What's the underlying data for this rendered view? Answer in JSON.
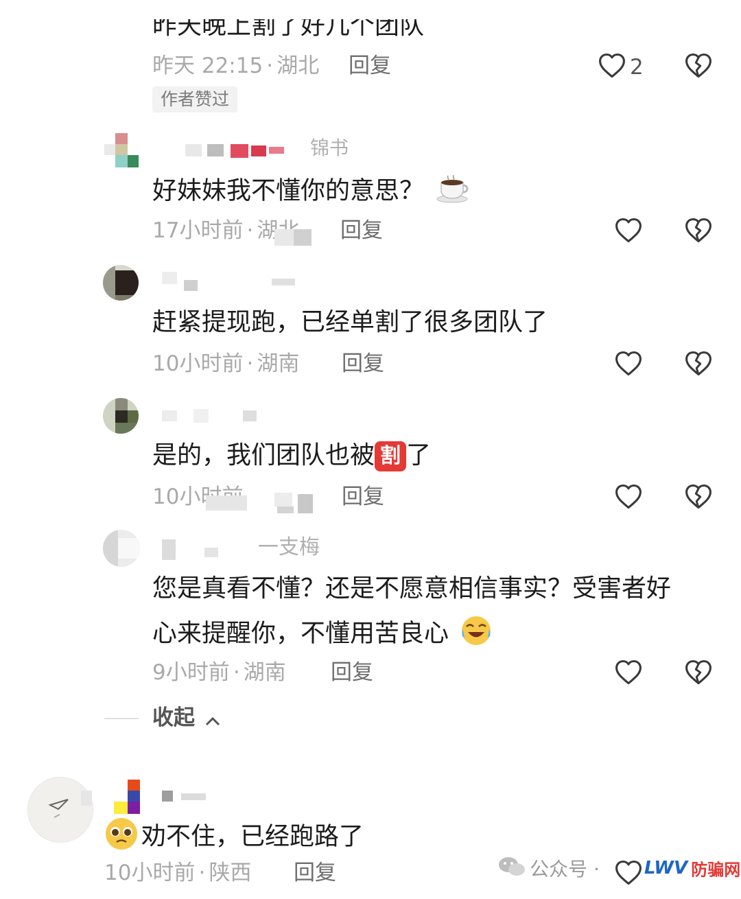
{
  "comments": [
    {
      "text": "昨天晚上割了好几个团队",
      "time": "昨天 22:15",
      "location": "湖北",
      "reply_label": "回复",
      "like_count": "2",
      "badge": "作者赞过"
    },
    {
      "username": "锦书",
      "text": "好妹妹我不懂你的意思？",
      "time": "17小时前",
      "location": "湖北",
      "reply_label": "回复"
    },
    {
      "text": "赶紧提现跑，已经单割了很多团队了",
      "time": "10小时前",
      "location": "湖南",
      "reply_label": "回复"
    },
    {
      "text_before": "是的，我们团队也被",
      "text_emoji": "割",
      "text_after": "了",
      "time": "10小时前",
      "reply_label": "回复"
    },
    {
      "username": "一支梅",
      "text_line1": "您是真看不懂？还是不愿意相信事实？受害者好",
      "text_line2": "心来提醒你，不懂用苦良心",
      "time": "9小时前",
      "location": "湖南",
      "reply_label": "回复"
    },
    {
      "text": "劝不住，已经跑路了",
      "time": "10小时前",
      "location": "陕西",
      "reply_label": "回复"
    }
  ],
  "collapse_label": "收起",
  "meta_separator": "·",
  "watermark": {
    "wechat_label": "公众号 ·",
    "site_label": "防骗网",
    "logo_text": "LWV"
  },
  "colors": {
    "text": "#1c1c1c",
    "meta": "#a9a9a9",
    "reply": "#6e6e6e",
    "icon": "#3a3a3a",
    "emoji_red": "#e53935",
    "emoji_yellow": "#f7c948"
  },
  "icons": [
    "heart-outline-icon",
    "broken-heart-icon",
    "coffee-emoji",
    "crying-laugh-emoji",
    "pleading-emoji",
    "chevron-up-icon",
    "wechat-icon"
  ]
}
